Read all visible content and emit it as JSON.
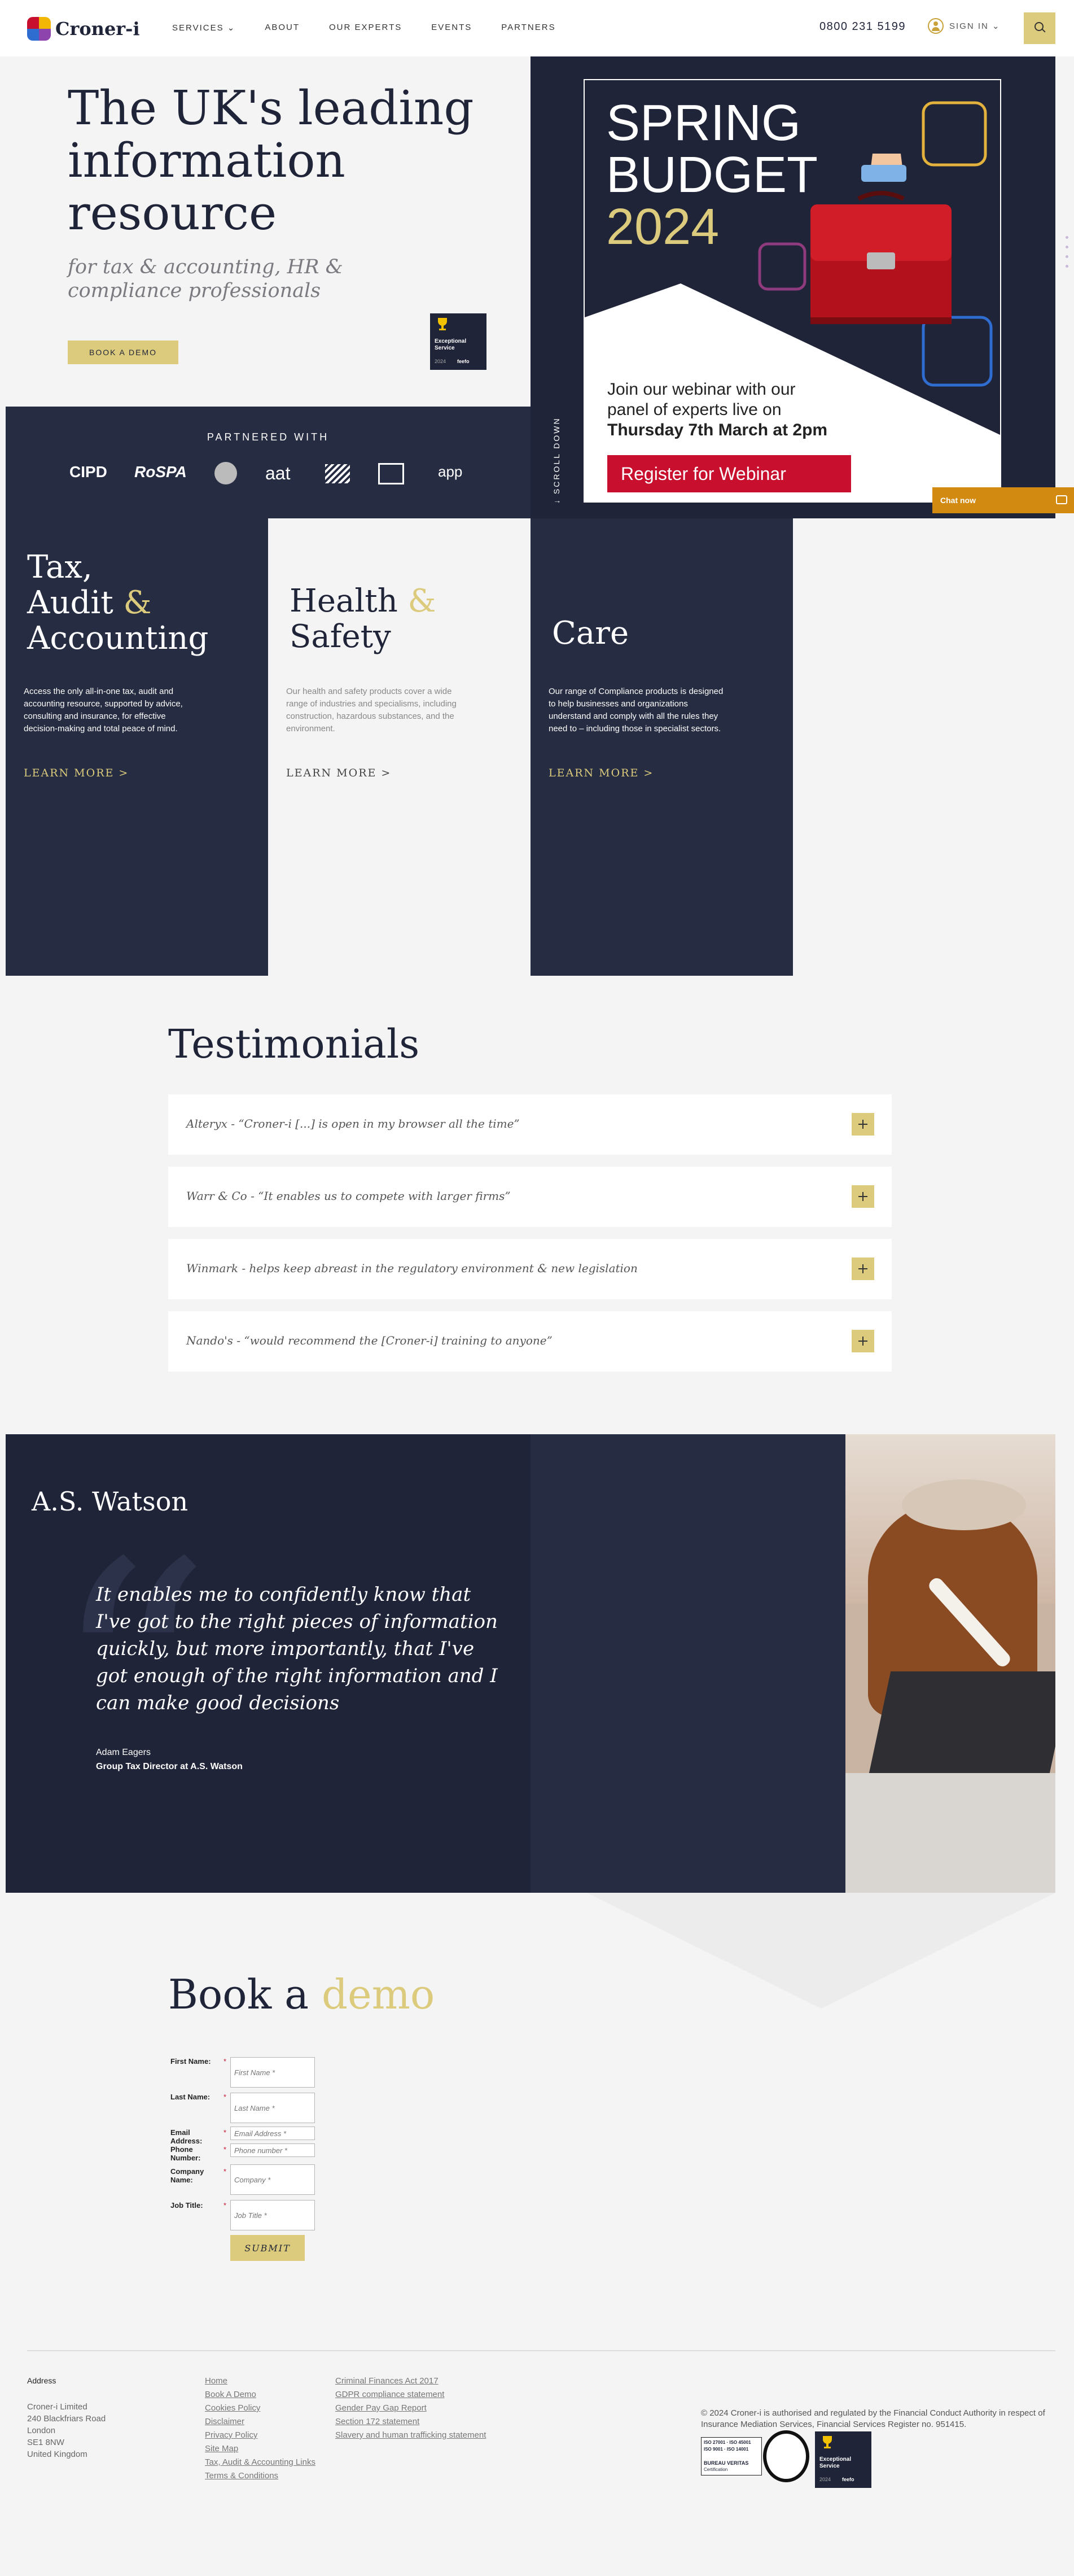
{
  "header": {
    "logo_text": "Croner-i",
    "nav": [
      "SERVICES ⌄",
      "ABOUT",
      "OUR EXPERTS",
      "EVENTS",
      "PARTNERS"
    ],
    "phone": "0800 231 5199",
    "signin": "SIGN IN ⌄"
  },
  "hero": {
    "title": "The UK's leading information resource",
    "subtitle": "for tax & accounting, HR & compliance professionals",
    "cta": "BOOK A DEMO",
    "badge": [
      "Exceptional",
      "Service",
      "2024"
    ],
    "badge_brand": "feefo",
    "partners_title": "PARTNERED WITH",
    "partners": [
      "CIPD",
      "RoSPA",
      "aat",
      "app"
    ],
    "scroll_label": "↓  SCROLL DOWN",
    "promo": {
      "line1": "SPRING",
      "line2": "BUDGET",
      "year": "2024",
      "text1": "Join our webinar with our panel of experts live on",
      "text2": "Thursday 7th March at 2pm",
      "button": "Register for Webinar"
    },
    "chat": "Chat now"
  },
  "categories": [
    {
      "title_a": "Tax,",
      "title_b": "Audit ",
      "amp": "&",
      "title_c": "Accounting",
      "text": "Access the only all-in-one tax, audit and accounting resource, supported by advice, consulting and insurance, for effective decision-making and total peace of mind.",
      "link": "LEARN MORE >"
    },
    {
      "title_a": "Health ",
      "amp": "&",
      "title_b": "Safety",
      "text": "Our health and safety products cover a wide range of industries and specialisms, including construction, hazardous substances, and the environment.",
      "link": "LEARN MORE >"
    },
    {
      "title_a": "Care",
      "text": "Our range of Compliance products is designed to help businesses and organizations understand and comply with all the rules they need to – including those in specialist sectors.",
      "link": "LEARN MORE >"
    }
  ],
  "testimonials": {
    "title": "Testimonials",
    "items": [
      "Alteryx - “Croner-i [...] is open in my browser all the time”",
      "Warr & Co - “It enables us to compete with larger firms”",
      "Winmark - helps keep abreast in the regulatory environment & new legislation",
      "Nando's - “would recommend the [Croner-i] training to anyone”"
    ]
  },
  "quote": {
    "company": "A.S. Watson",
    "mark": "“",
    "text": "It enables me to confidently know that I've got to the right pieces of information quickly, but more importantly, that I've got enough of the right information and I can make good decisions",
    "author": "Adam Eagers",
    "role": "Group Tax Director at A.S. Watson"
  },
  "demo_form": {
    "title_a": "Book a ",
    "title_b": "demo",
    "fields": [
      {
        "label": "First Name:",
        "placeholder": "First Name *"
      },
      {
        "label": "Last Name:",
        "placeholder": "Last Name *"
      },
      {
        "label": "Email Address:",
        "placeholder": "Email Address *"
      },
      {
        "label": "Phone Number:",
        "placeholder": "Phone number *"
      },
      {
        "label": "Company Name:",
        "placeholder": "Company *"
      },
      {
        "label": "Job Title:",
        "placeholder": "Job Title *"
      }
    ],
    "required_mark": "*",
    "submit": "SUBMIT"
  },
  "footer": {
    "address_title": "Address",
    "address": [
      "Croner-i Limited",
      "240 Blackfriars Road",
      "London",
      "SE1 8NW",
      "United Kingdom"
    ],
    "links_col1": [
      "Home",
      "Book A Demo",
      "Cookies Policy",
      "Disclaimer",
      "Privacy Policy",
      "Site Map",
      "Tax, Audit & Accounting Links",
      "Terms & Conditions"
    ],
    "links_col2": [
      "Criminal Finances Act 2017",
      "GDPR compliance statement",
      "Gender Pay Gap Report",
      "Section 172 statement",
      "Slavery and human trafficking statement"
    ],
    "copyright": "© 2024 Croner-i is authorised and regulated by the Financial Conduct Authority in respect of Insurance Mediation Services, Financial Services Register no. 951415.",
    "cert_text": [
      "ISO 27001 · ISO 45001",
      "ISO 9001 · ISO 14001",
      "BUREAU VERITAS",
      "Certification"
    ]
  },
  "colors": {
    "navy": "#1f2438",
    "gold": "#dccb7c",
    "red": "#c8102e",
    "chat": "#d28a10"
  }
}
